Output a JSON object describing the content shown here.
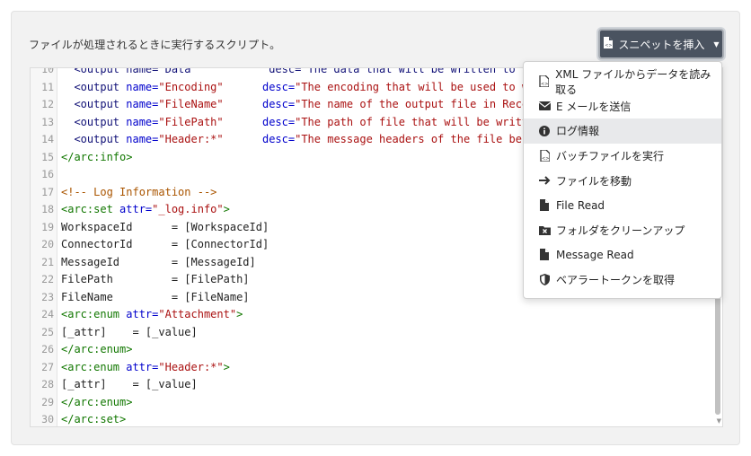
{
  "panel": {
    "description": "ファイルが処理されるときに実行するスクリプト。"
  },
  "toolbar": {
    "insert_snippet_label": "スニペットを挿入",
    "insert_icon": "code-file-icon",
    "caret_icon": "caret-down-icon"
  },
  "editor": {
    "lines": [
      {
        "n": "10",
        "parts": [
          {
            "c": "tag-b",
            "t": "  <output name=\"Data\"           desc=\"The data that will be written to the file being\""
          }
        ]
      },
      {
        "n": "11",
        "parts": [
          {
            "c": "tag-b",
            "t": "  <output "
          },
          {
            "c": "attr",
            "t": "name="
          },
          {
            "c": "str",
            "t": "\"Encoding\""
          },
          {
            "c": "",
            "t": "      "
          },
          {
            "c": "attr",
            "t": "desc="
          },
          {
            "c": "str",
            "t": "\"The encoding that will be used to write the"
          }
        ]
      },
      {
        "n": "12",
        "parts": [
          {
            "c": "tag-b",
            "t": "  <output "
          },
          {
            "c": "attr",
            "t": "name="
          },
          {
            "c": "str",
            "t": "\"FileName\""
          },
          {
            "c": "",
            "t": "      "
          },
          {
            "c": "attr",
            "t": "desc="
          },
          {
            "c": "str",
            "t": "\"The name of the output file in Receive folde"
          }
        ]
      },
      {
        "n": "13",
        "parts": [
          {
            "c": "tag-b",
            "t": "  <output "
          },
          {
            "c": "attr",
            "t": "name="
          },
          {
            "c": "str",
            "t": "\"FilePath\""
          },
          {
            "c": "",
            "t": "      "
          },
          {
            "c": "attr",
            "t": "desc="
          },
          {
            "c": "str",
            "t": "\"The path of file that will be written to Re"
          }
        ]
      },
      {
        "n": "14",
        "parts": [
          {
            "c": "tag-b",
            "t": "  <output "
          },
          {
            "c": "attr",
            "t": "name="
          },
          {
            "c": "str",
            "t": "\"Header:*\""
          },
          {
            "c": "",
            "t": "      "
          },
          {
            "c": "attr",
            "t": "desc="
          },
          {
            "c": "str",
            "t": "\"The message headers of the file being writte"
          }
        ]
      },
      {
        "n": "15",
        "parts": [
          {
            "c": "tag",
            "t": "</arc:info>"
          }
        ]
      },
      {
        "n": "16",
        "parts": [
          {
            "c": "",
            "t": ""
          }
        ]
      },
      {
        "n": "17",
        "parts": [
          {
            "c": "cmt",
            "t": "<!-- Log Information -->"
          }
        ]
      },
      {
        "n": "18",
        "parts": [
          {
            "c": "tag",
            "t": "<arc:set "
          },
          {
            "c": "attr",
            "t": "attr="
          },
          {
            "c": "str",
            "t": "\"_log.info\""
          },
          {
            "c": "tag",
            "t": ">"
          }
        ]
      },
      {
        "n": "19",
        "parts": [
          {
            "c": "",
            "t": "WorkspaceId      = [WorkspaceId]"
          }
        ]
      },
      {
        "n": "20",
        "parts": [
          {
            "c": "",
            "t": "ConnectorId      = [ConnectorId]"
          }
        ]
      },
      {
        "n": "21",
        "parts": [
          {
            "c": "",
            "t": "MessageId        = [MessageId]"
          }
        ]
      },
      {
        "n": "22",
        "parts": [
          {
            "c": "",
            "t": "FilePath         = [FilePath]"
          }
        ]
      },
      {
        "n": "23",
        "parts": [
          {
            "c": "",
            "t": "FileName         = [FileName]"
          }
        ]
      },
      {
        "n": "24",
        "parts": [
          {
            "c": "tag",
            "t": "<arc:enum "
          },
          {
            "c": "attr",
            "t": "attr="
          },
          {
            "c": "str",
            "t": "\"Attachment\""
          },
          {
            "c": "tag",
            "t": ">"
          }
        ]
      },
      {
        "n": "25",
        "parts": [
          {
            "c": "",
            "t": "[_attr]    = [_value]"
          }
        ]
      },
      {
        "n": "26",
        "parts": [
          {
            "c": "tag",
            "t": "</arc:enum>"
          }
        ]
      },
      {
        "n": "27",
        "parts": [
          {
            "c": "tag",
            "t": "<arc:enum "
          },
          {
            "c": "attr",
            "t": "attr="
          },
          {
            "c": "str",
            "t": "\"Header:*\""
          },
          {
            "c": "tag",
            "t": ">"
          }
        ]
      },
      {
        "n": "28",
        "parts": [
          {
            "c": "",
            "t": "[_attr]    = [_value]"
          }
        ]
      },
      {
        "n": "29",
        "parts": [
          {
            "c": "tag",
            "t": "</arc:enum>"
          }
        ]
      },
      {
        "n": "30",
        "parts": [
          {
            "c": "tag",
            "t": "</arc:set>"
          }
        ]
      }
    ]
  },
  "dropdown": {
    "items": [
      {
        "label": "XML ファイルからデータを読み取る",
        "icon": "code-file-icon",
        "hover": false
      },
      {
        "label": "E メールを送信",
        "icon": "envelope-icon",
        "hover": false
      },
      {
        "label": "ログ情報",
        "icon": "info-circle-icon",
        "hover": true
      },
      {
        "label": "バッチファイルを実行",
        "icon": "code-file-icon",
        "hover": false
      },
      {
        "label": "ファイルを移動",
        "icon": "arrow-right-icon",
        "hover": false
      },
      {
        "label": "File Read",
        "icon": "file-icon",
        "hover": false
      },
      {
        "label": "フォルダをクリーンアップ",
        "icon": "folder-x-icon",
        "hover": false
      },
      {
        "label": "Message Read",
        "icon": "file-icon",
        "hover": false
      },
      {
        "label": "ベアラートークンを取得",
        "icon": "shield-icon",
        "hover": false
      }
    ]
  }
}
